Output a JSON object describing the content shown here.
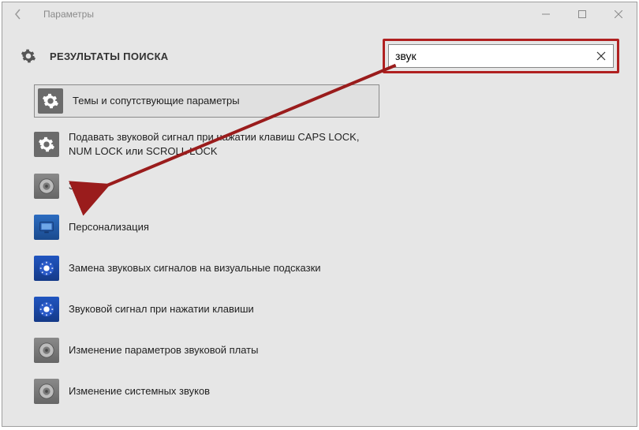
{
  "window": {
    "title": "Параметры"
  },
  "header": {
    "page_title": "РЕЗУЛЬТАТЫ ПОИСКА"
  },
  "search": {
    "value": "звук"
  },
  "results": [
    {
      "icon": "gear",
      "label": "Темы и сопутствующие параметры",
      "selected": true
    },
    {
      "icon": "gear",
      "label": "Подавать звуковой сигнал при нажатии клавиш CAPS LOCK, NUM LOCK или SCROLL LOCK",
      "selected": false
    },
    {
      "icon": "speaker",
      "label": "Звук",
      "selected": false
    },
    {
      "icon": "monitor",
      "label": "Персонализация",
      "selected": false
    },
    {
      "icon": "acc",
      "label": "Замена звуковых сигналов на визуальные подсказки",
      "selected": false
    },
    {
      "icon": "acc",
      "label": "Звуковой сигнал при нажатии клавиши",
      "selected": false
    },
    {
      "icon": "speaker",
      "label": "Изменение параметров звуковой платы",
      "selected": false
    },
    {
      "icon": "speaker",
      "label": "Изменение системных звуков",
      "selected": false
    }
  ],
  "annotation": {
    "highlight_color": "#b02020"
  }
}
